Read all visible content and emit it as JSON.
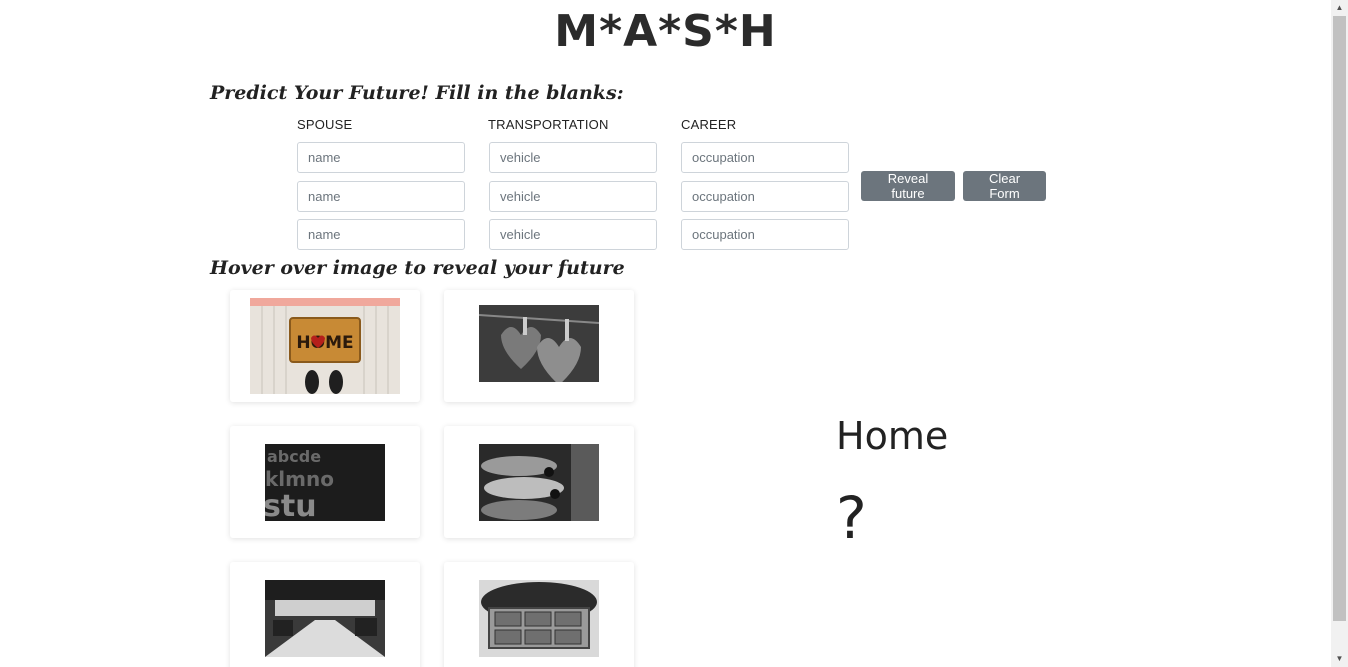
{
  "title": "M*A*S*H",
  "subtitle": "Predict Your Future! Fill in the blanks:",
  "columns": {
    "spouse": {
      "label": "SPOUSE",
      "placeholder": "name"
    },
    "transportation": {
      "label": "TRANSPORTATION",
      "placeholder": "vehicle"
    },
    "career": {
      "label": "CAREER",
      "placeholder": "occupation"
    }
  },
  "buttons": {
    "reveal": "Reveal future",
    "clear": "Clear Form"
  },
  "hover_title": "Hover over image to reveal your future",
  "images": [
    {
      "name": "home",
      "icon": "doormat-home-image"
    },
    {
      "name": "love",
      "icon": "hearts-image"
    },
    {
      "name": "letters",
      "icon": "letters-image"
    },
    {
      "name": "cars",
      "icon": "cars-image"
    },
    {
      "name": "office",
      "icon": "office-image"
    },
    {
      "name": "money",
      "icon": "money-case-image"
    }
  ],
  "mat_text": "HOME",
  "result": {
    "label": "Home",
    "value": "?"
  }
}
